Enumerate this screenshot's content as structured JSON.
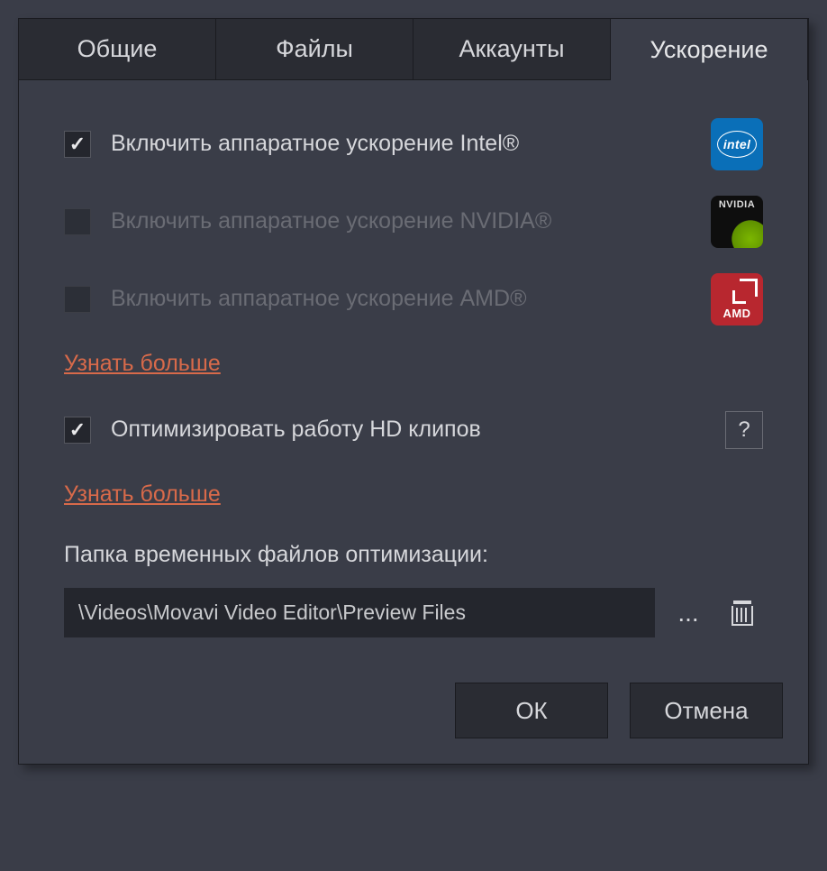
{
  "tabs": [
    {
      "label": "Общие",
      "active": false
    },
    {
      "label": "Файлы",
      "active": false
    },
    {
      "label": "Аккаунты",
      "active": false
    },
    {
      "label": "Ускорение",
      "active": true
    }
  ],
  "accel": {
    "intel": {
      "label": "Включить аппаратное ускорение Intel®",
      "checked": true,
      "enabled": true
    },
    "nvidia": {
      "label": "Включить аппаратное ускорение NVIDIA®",
      "checked": false,
      "enabled": false
    },
    "amd": {
      "label": "Включить аппаратное ускорение AMD®",
      "checked": false,
      "enabled": false
    }
  },
  "learn_more_1": "Узнать больше",
  "hd_optimize": {
    "label": "Оптимизировать работу HD клипов",
    "checked": true
  },
  "help_symbol": "?",
  "learn_more_2": "Узнать больше",
  "temp_folder_label": "Папка временных файлов оптимизации:",
  "temp_folder_path": "\\Videos\\Movavi Video Editor\\Preview Files",
  "browse_symbol": "...",
  "buttons": {
    "ok": "ОК",
    "cancel": "Отмена"
  },
  "brands": {
    "intel": "intel",
    "nvidia": "NVIDIA",
    "amd": "AMD"
  }
}
